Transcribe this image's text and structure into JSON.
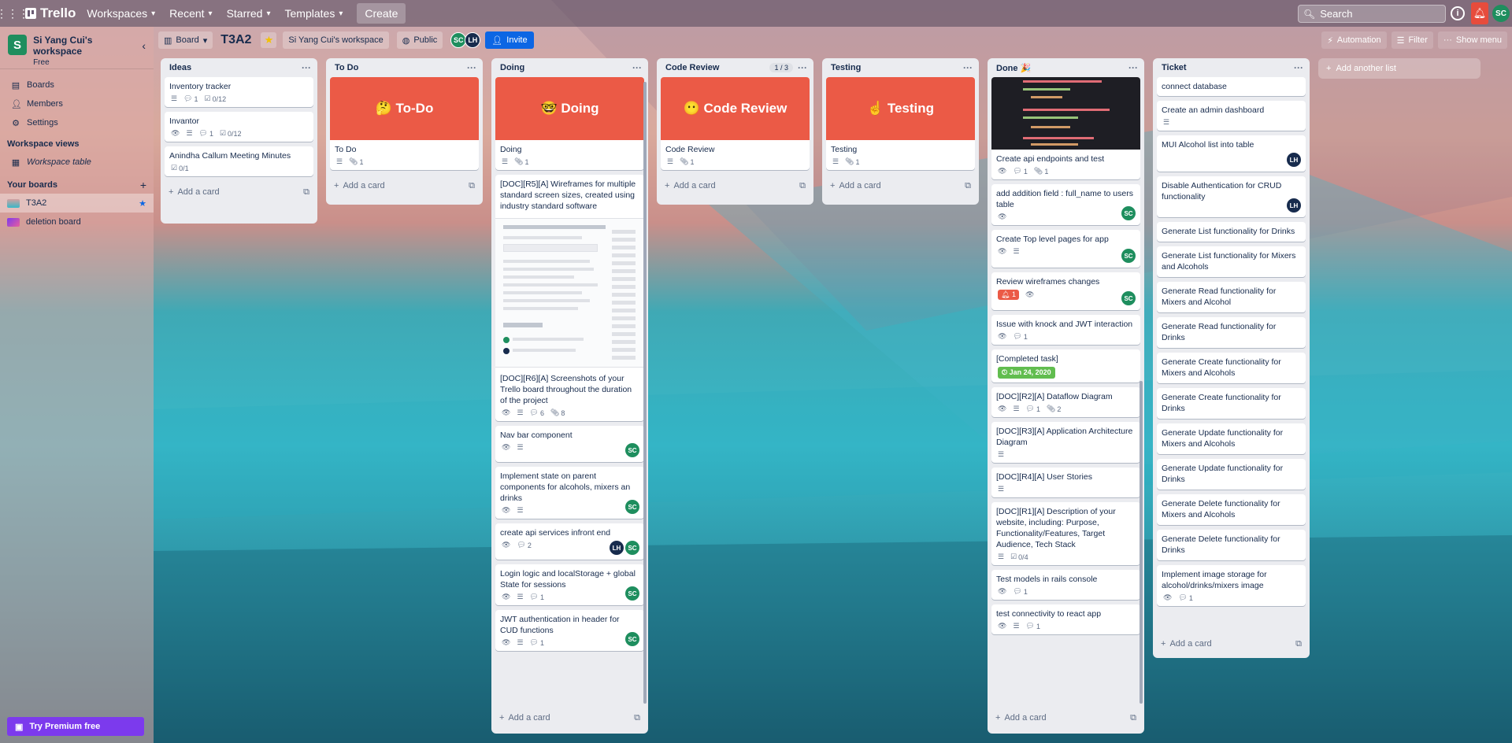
{
  "topbar": {
    "brand": "Trello",
    "nav": [
      "Workspaces",
      "Recent",
      "Starred",
      "Templates"
    ],
    "create": "Create",
    "search_placeholder": "Search",
    "avatar": "SC"
  },
  "sidebar": {
    "workspace_name": "Si Yang Cui's workspace",
    "workspace_initial": "S",
    "plan": "Free",
    "items": [
      "Boards",
      "Members",
      "Settings"
    ],
    "views_heading": "Workspace views",
    "views": [
      "Workspace table"
    ],
    "boards_heading": "Your boards",
    "boards": [
      "T3A2",
      "deletion board"
    ],
    "premium": "Try Premium free"
  },
  "board": {
    "view": "Board",
    "title": "T3A2",
    "workspace": "Si Yang Cui's workspace",
    "visibility": "Public",
    "members": [
      "SC",
      "LH"
    ],
    "invite": "Invite",
    "automation": "Automation",
    "filter": "Filter",
    "menu": "Show menu",
    "add_list": "Add another list",
    "add_card": "Add a card"
  },
  "lists": {
    "ideas": {
      "title": "Ideas",
      "cards": [
        {
          "title": "Inventory tracker",
          "comments": "1",
          "checklist": "0/12"
        },
        {
          "title": "Invantor",
          "comments": "1",
          "checklist": "0/12"
        },
        {
          "title": "Anindha Callum Meeting Minutes",
          "checklist": "0/1"
        }
      ]
    },
    "todo": {
      "title": "To Do",
      "cover": "🤔 To-Do",
      "card": "To Do",
      "attach": "1"
    },
    "doing": {
      "title": "Doing",
      "cover": "🤓 Doing",
      "cards": [
        {
          "title": "Doing",
          "attach": "1"
        },
        {
          "title": "[DOC][R5][A] Wireframes for multiple standard screen sizes, created using industry standard software"
        },
        {
          "title": "[DOC][R6][A] Screenshots of your Trello board throughout the duration of the project",
          "comments": "6",
          "attach": "8"
        },
        {
          "title": "Nav bar component"
        },
        {
          "title": "Implement state on parent components for alcohols, mixers an drinks"
        },
        {
          "title": "create api services infront end",
          "comments": "2"
        },
        {
          "title": "Login logic and localStorage + global State for sessions",
          "comments": "1"
        },
        {
          "title": "JWT authentication in header for CUD functions",
          "comments": "1"
        }
      ]
    },
    "review": {
      "title": "Code Review",
      "count": "1 / 3",
      "cover": "😶 Code Review",
      "card": "Code Review",
      "attach": "1"
    },
    "testing": {
      "title": "Testing",
      "cover": "☝️ Testing",
      "card": "Testing",
      "attach": "1"
    },
    "done": {
      "title": "Done 🎉",
      "cards": [
        {
          "title": "Create api endpoints and test",
          "comments": "1",
          "attach": "1"
        },
        {
          "title": "add addition field : full_name to users table"
        },
        {
          "title": "Create Top level pages for app"
        },
        {
          "title": "Review wireframes changes",
          "alert": "1"
        },
        {
          "title": "Issue with knock and JWT interaction",
          "comments": "1"
        },
        {
          "title": "[Completed task]",
          "date": "Jan 24, 2020"
        },
        {
          "title": "[DOC][R2][A] Dataflow Diagram",
          "comments": "1",
          "attach": "2"
        },
        {
          "title": "[DOC][R3][A] Application Architecture Diagram"
        },
        {
          "title": "[DOC][R4][A] User Stories"
        },
        {
          "title": "[DOC][R1][A] Description of your website, including: Purpose, Functionality/Features, Target Audience, Tech Stack",
          "checklist": "0/4"
        },
        {
          "title": "Test models in rails console",
          "comments": "1"
        },
        {
          "title": "test connectivity to react app",
          "comments": "1"
        }
      ]
    },
    "ticket": {
      "title": "Ticket",
      "cards": [
        {
          "title": "connect database"
        },
        {
          "title": "Create an admin dashboard"
        },
        {
          "title": "MUI Alcohol list into table"
        },
        {
          "title": "Disable Authentication for CRUD functionality"
        },
        {
          "title": "Generate List functionality for Drinks"
        },
        {
          "title": "Generate List functionality for Mixers and Alcohols"
        },
        {
          "title": "Generate Read functionality for Mixers and Alcohol"
        },
        {
          "title": "Generate Read functionality for Drinks"
        },
        {
          "title": "Generate Create functionality for Mixers and Alcohols"
        },
        {
          "title": "Generate Create functionality for Drinks"
        },
        {
          "title": "Generate Update functionality for Mixers and Alcohols"
        },
        {
          "title": "Generate Update functionality for Drinks"
        },
        {
          "title": "Generate Delete functionality for Mixers and Alcohols"
        },
        {
          "title": "Generate Delete functionality for Drinks"
        },
        {
          "title": "Implement image storage for alcohol/drinks/mixers image",
          "comments": "1"
        }
      ]
    }
  },
  "colors": {
    "cover": "#eb5a46",
    "member_sc": "#1e8e5e",
    "member_lh": "#172b4d",
    "invite": "#0c66e4",
    "premium": "#7c3aed"
  }
}
